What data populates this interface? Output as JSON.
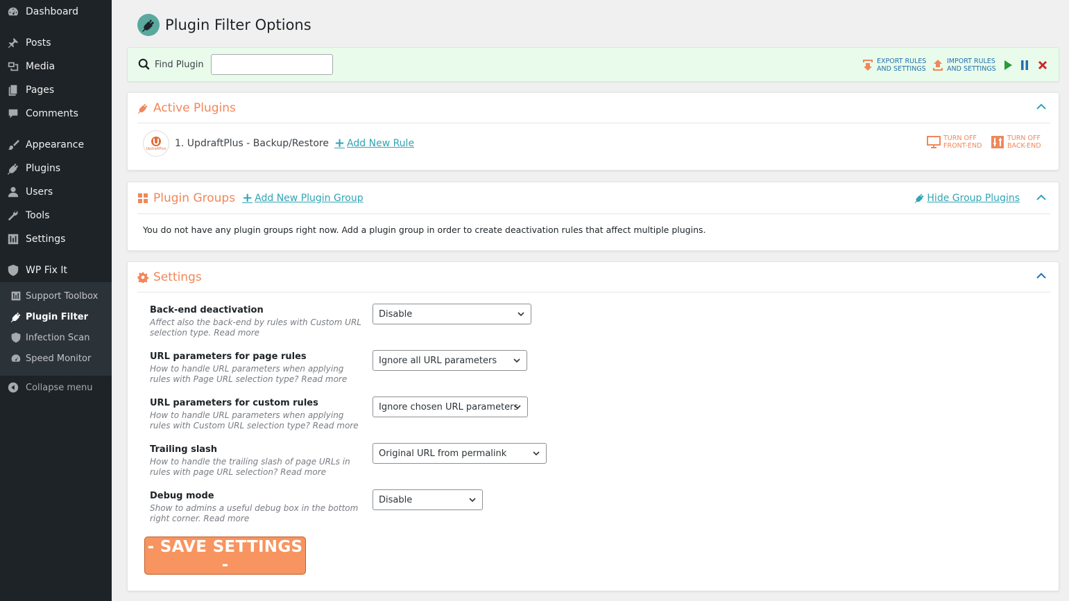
{
  "sidebar": {
    "items": [
      {
        "label": "Dashboard",
        "icon": "dashboard-icon"
      },
      {
        "label": "Posts",
        "icon": "pin-icon"
      },
      {
        "label": "Media",
        "icon": "media-icon"
      },
      {
        "label": "Pages",
        "icon": "pages-icon"
      },
      {
        "label": "Comments",
        "icon": "comment-icon"
      },
      {
        "label": "Appearance",
        "icon": "brush-icon"
      },
      {
        "label": "Plugins",
        "icon": "plug-icon"
      },
      {
        "label": "Users",
        "icon": "user-icon"
      },
      {
        "label": "Tools",
        "icon": "wrench-icon"
      },
      {
        "label": "Settings",
        "icon": "sliders-icon"
      },
      {
        "label": "WP Fix It",
        "icon": "shield-icon"
      }
    ],
    "submenu": [
      {
        "label": "Support Toolbox",
        "icon": "toolbox-icon"
      },
      {
        "label": "Plugin Filter",
        "icon": "plug-icon"
      },
      {
        "label": "Infection Scan",
        "icon": "shield-icon"
      },
      {
        "label": "Speed Monitor",
        "icon": "gauge-icon"
      }
    ],
    "collapse_label": "Collapse menu"
  },
  "page": {
    "title": "Plugin Filter Options"
  },
  "toolbar": {
    "find_label": "Find Plugin",
    "find_value": "",
    "export_line1": "EXPORT RULES",
    "export_line2": "AND SETTINGS",
    "import_line1": "IMPORT RULES",
    "import_line2": "AND SETTINGS"
  },
  "active_plugins": {
    "title": "Active Plugins",
    "plugin_name": "1. UpdraftPlus - Backup/Restore",
    "plugin_logo_text": "UpdraftPlus",
    "add_rule": "Add New Rule",
    "front_line1": "TURN OFF",
    "front_line2": "FRONT-END",
    "back_line1": "TURN OFF",
    "back_line2": "BACK-END"
  },
  "plugin_groups": {
    "title": "Plugin Groups",
    "add_group": "Add New Plugin Group",
    "hide_link": "Hide Group Plugins",
    "empty_text": "You do not have any plugin groups right now. Add a plugin group in order to create deactivation rules that affect multiple plugins."
  },
  "settings": {
    "title": "Settings",
    "read_more": "Read more",
    "rows": [
      {
        "label": "Back-end deactivation",
        "desc": "Affect also the back-end by rules with Custom URL selection type.",
        "value": "Disable"
      },
      {
        "label": "URL parameters for page rules",
        "desc": "How to handle URL parameters when applying rules with Page URL selection type?",
        "value": "Ignore all URL parameters"
      },
      {
        "label": "URL parameters for custom rules",
        "desc": "How to handle URL parameters when applying rules with Custom URL selection type?",
        "value": "Ignore chosen URL parameters"
      },
      {
        "label": "Trailing slash",
        "desc": "How to handle the trailing slash of page URLs in rules with page URL selection?",
        "value": "Original URL from permalink"
      },
      {
        "label": "Debug mode",
        "desc": "Show to admins a useful debug box in the bottom right corner.",
        "value": "Disable"
      }
    ],
    "save_label": "- SAVE SETTINGS -"
  },
  "colors": {
    "accent": "#f0875a",
    "link": "#2fa5b5",
    "sidebar_bg": "#1d2327",
    "toolbar_bg": "#e9fbea"
  }
}
